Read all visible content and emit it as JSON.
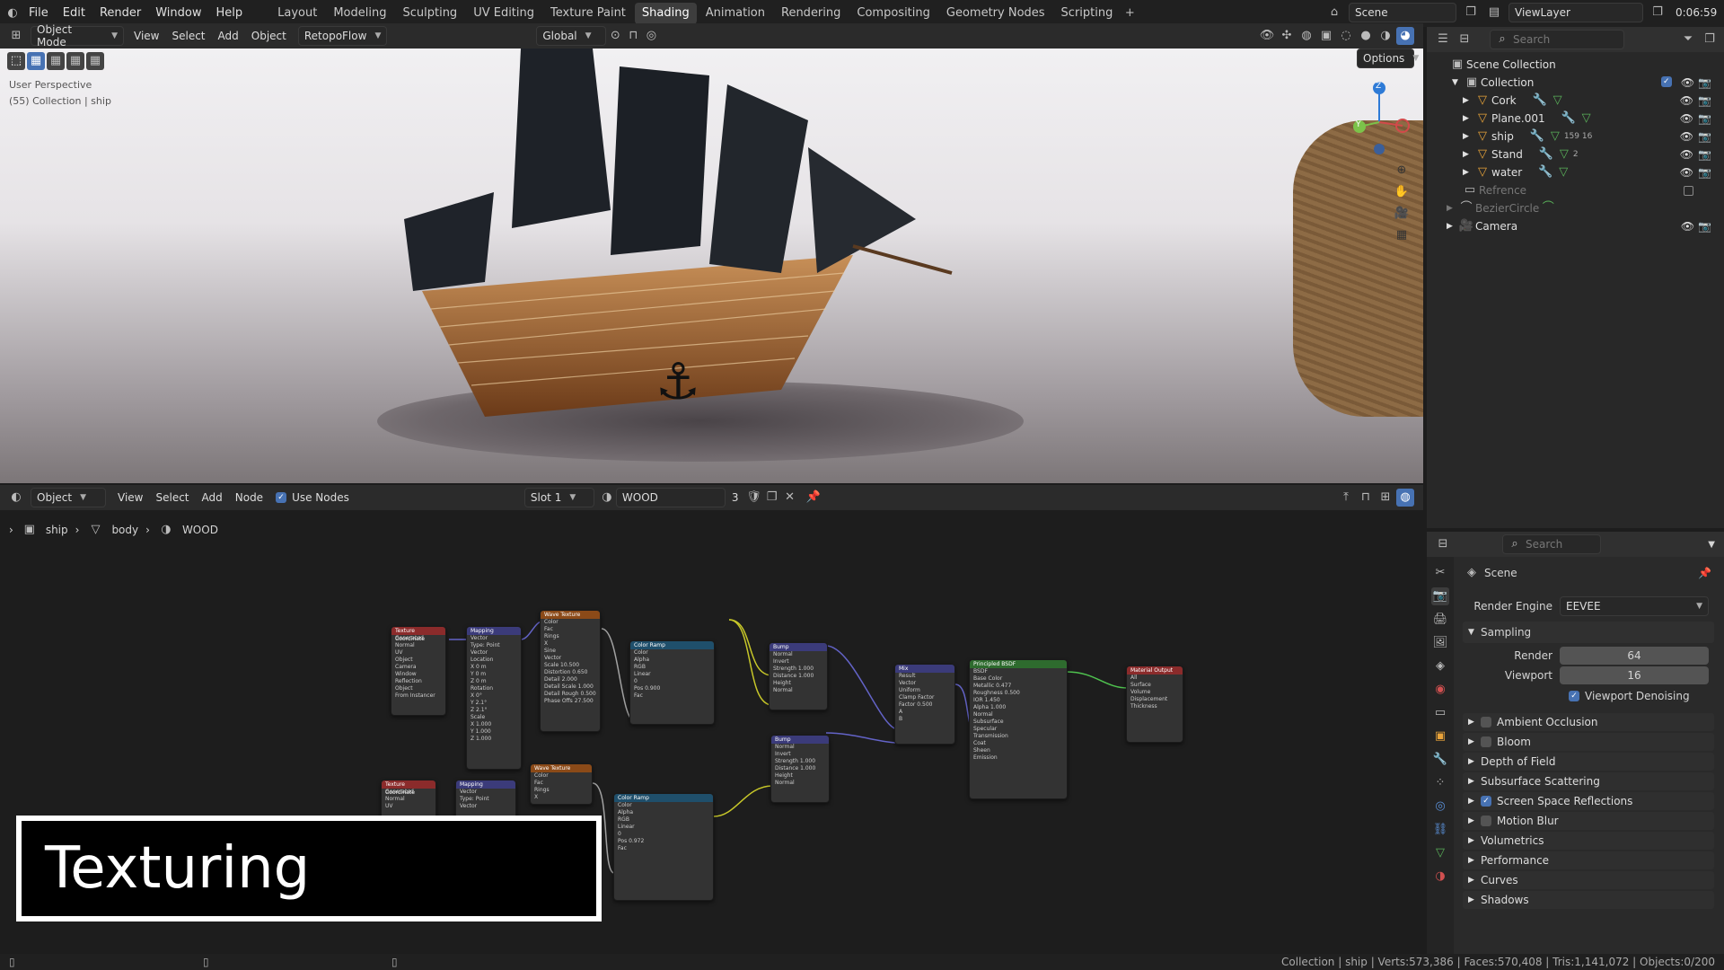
{
  "menus": [
    "File",
    "Edit",
    "Render",
    "Window",
    "Help"
  ],
  "workspaces": [
    "Layout",
    "Modeling",
    "Sculpting",
    "UV Editing",
    "Texture Paint",
    "Shading",
    "Animation",
    "Rendering",
    "Compositing",
    "Geometry Nodes",
    "Scripting"
  ],
  "active_workspace": "Shading",
  "scene": "Scene",
  "view_layer": "ViewLayer",
  "clock": "0:06:59",
  "viewport": {
    "mode": "Object Mode",
    "menus": [
      "View",
      "Select",
      "Add",
      "Object"
    ],
    "addon": "RetopoFlow",
    "transform": "Global",
    "options": "Options",
    "overlay_title": "User Perspective",
    "overlay_sub": "(55) Collection | ship",
    "axes": {
      "x": "X",
      "y": "Y",
      "z": "Z"
    }
  },
  "outliner": {
    "search": "Search",
    "root": "Scene Collection",
    "collection": "Collection",
    "items": [
      {
        "name": "Cork"
      },
      {
        "name": "Plane.001"
      },
      {
        "name": "ship",
        "extra": "159 16"
      },
      {
        "name": "Stand",
        "extra": "2"
      },
      {
        "name": "water"
      }
    ],
    "refrence": "Refrence",
    "bezier": "BezierCircle",
    "camera": "Camera"
  },
  "node_editor": {
    "mode": "Object",
    "menus": [
      "View",
      "Select",
      "Add",
      "Node"
    ],
    "use_nodes": "Use Nodes",
    "slot": "Slot 1",
    "material": "WOOD",
    "users": "3",
    "breadcrumb": [
      "ship",
      "body",
      "WOOD"
    ]
  },
  "nodes": [
    {
      "title": "Texture Coordinate",
      "color": "#8b2b2b",
      "rows": [
        "Generated",
        "Normal",
        "UV",
        "Object",
        "Camera",
        "Window",
        "Reflection",
        "Object",
        "From Instancer"
      ]
    },
    {
      "title": "Mapping",
      "color": "#3b3b7a",
      "rows": [
        "Vector",
        "Type: Point",
        "Vector",
        "Location",
        "X 0 m",
        "Y 0 m",
        "Z 0 m",
        "Rotation",
        "X 0°",
        "Y 2.1°",
        "Z 2.1°",
        "Scale",
        "X 1.000",
        "Y 1.000",
        "Z 1.000"
      ]
    },
    {
      "title": "Wave Texture",
      "color": "#8b4a18",
      "rows": [
        "Color",
        "Fac",
        "Rings",
        "X",
        "Sine",
        "Vector",
        "Scale 10.500",
        "Distortion 0.650",
        "Detail 2.000",
        "Detail Scale 1.000",
        "Detail Rough 0.500",
        "Phase Offs 27.500"
      ]
    },
    {
      "title": "Color Ramp",
      "color": "#1f4f6b",
      "rows": [
        "Color",
        "Alpha",
        "RGB",
        "Linear",
        "0",
        "Pos 0.900",
        "Fac"
      ]
    },
    {
      "title": "Bump",
      "color": "#3b3b7a",
      "rows": [
        "Normal",
        "Invert",
        "Strength 1.000",
        "Distance 1.000",
        "Height",
        "Normal"
      ]
    },
    {
      "title": "Bump",
      "color": "#3b3b7a",
      "rows": [
        "Normal",
        "Invert",
        "Strength 1.000",
        "Distance 1.000",
        "Height",
        "Normal"
      ]
    },
    {
      "title": "Mix",
      "color": "#3b3b7a",
      "rows": [
        "Result",
        "Vector",
        "Uniform",
        "Clamp Factor",
        "Factor 0.500",
        "A",
        "B"
      ]
    },
    {
      "title": "Principled BSDF",
      "color": "#2e6b2e",
      "rows": [
        "BSDF",
        "Base Color",
        "Metallic 0.477",
        "Roughness 0.500",
        "IOR 1.450",
        "Alpha 1.000",
        "Normal",
        "Subsurface",
        "Specular",
        "Transmission",
        "Coat",
        "Sheen",
        "Emission"
      ]
    },
    {
      "title": "Material Output",
      "color": "#8b2b2b",
      "rows": [
        "All",
        "Surface",
        "Volume",
        "Displacement",
        "Thickness"
      ]
    },
    {
      "title": "Texture Coordinate",
      "color": "#8b2b2b",
      "rows": [
        "Generated",
        "Normal",
        "UV"
      ]
    },
    {
      "title": "Mapping",
      "color": "#3b3b7a",
      "rows": [
        "Vector",
        "Type: Point",
        "Vector"
      ]
    },
    {
      "title": "Wave Texture",
      "color": "#8b4a18",
      "rows": [
        "Color",
        "Fac",
        "Rings",
        "X"
      ]
    },
    {
      "title": "Color Ramp",
      "color": "#1f4f6b",
      "rows": [
        "Color",
        "Alpha",
        "RGB",
        "Linear",
        "0",
        "Pos 0.972",
        "Fac"
      ]
    }
  ],
  "properties": {
    "search": "Search",
    "scene": "Scene",
    "render_engine_label": "Render Engine",
    "render_engine": "EEVEE",
    "sampling": "Sampling",
    "render_label": "Render",
    "render_val": "64",
    "viewport_label": "Viewport",
    "viewport_val": "16",
    "denoise": "Viewport Denoising",
    "panels": [
      "Ambient Occlusion",
      "Bloom",
      "Depth of Field",
      "Subsurface Scattering",
      "Screen Space Reflections",
      "Motion Blur",
      "Volumetrics",
      "Performance",
      "Curves",
      "Shadows"
    ]
  },
  "caption": "Texturing",
  "status": "Collection | ship | Verts:573,386 | Faces:570,408 | Tris:1,141,072 | Objects:0/200"
}
